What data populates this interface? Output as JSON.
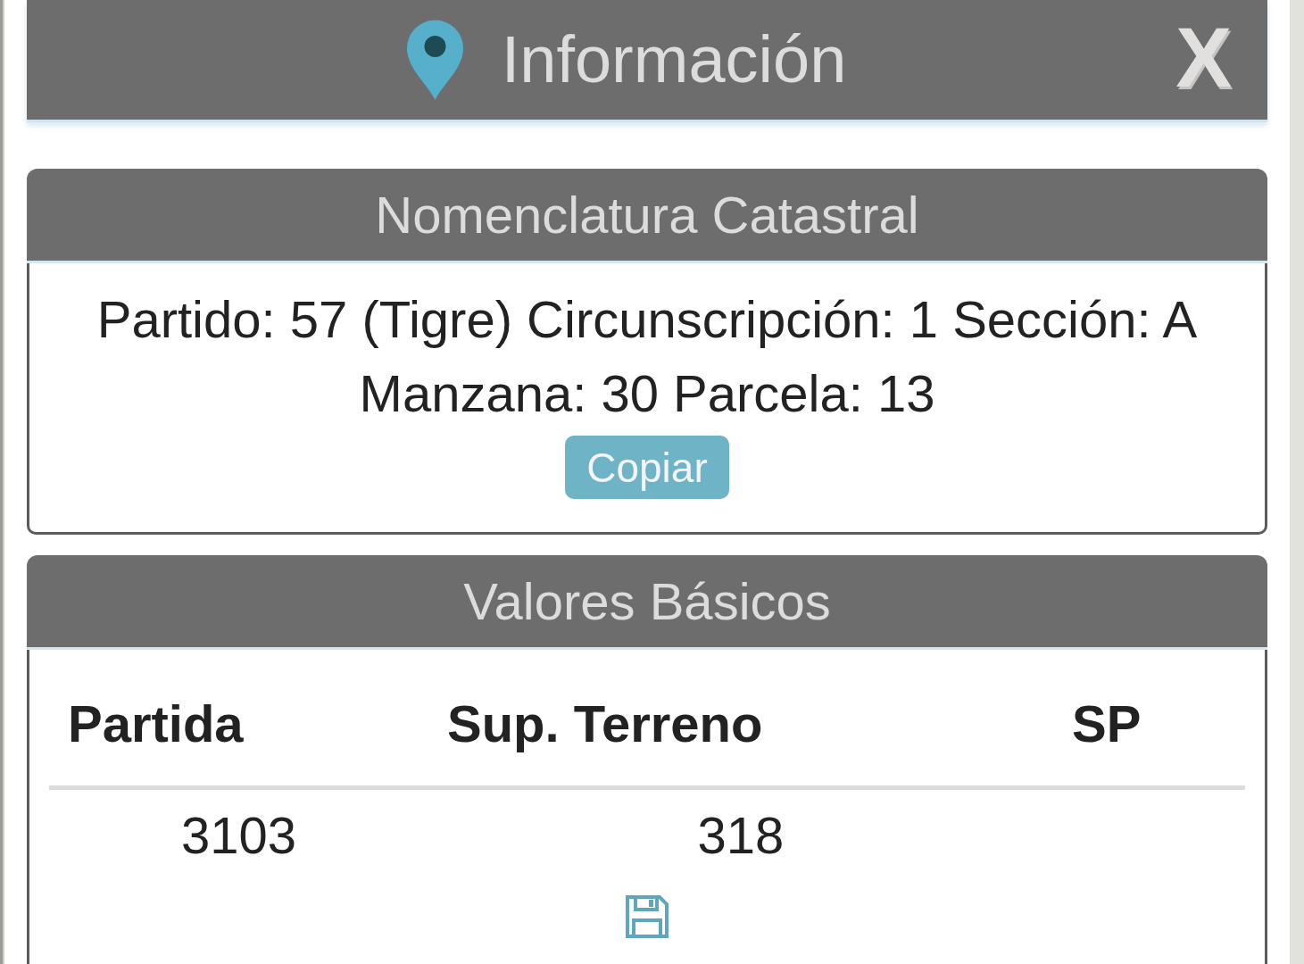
{
  "panel": {
    "title": "Información",
    "close_label": "X",
    "sections": [
      {
        "kind": "text",
        "title": "Nomenclatura Catastral",
        "text": "Partido: 57 (Tigre) Circunscripción: 1 Sección: A Manzana: 30 Parcela: 13",
        "button": "Copiar"
      },
      {
        "kind": "table",
        "title": "Valores Básicos",
        "columns": [
          "Partida",
          "Sup. Terreno",
          "SP"
        ],
        "rows": [
          [
            "3103",
            "318"
          ]
        ]
      }
    ]
  }
}
